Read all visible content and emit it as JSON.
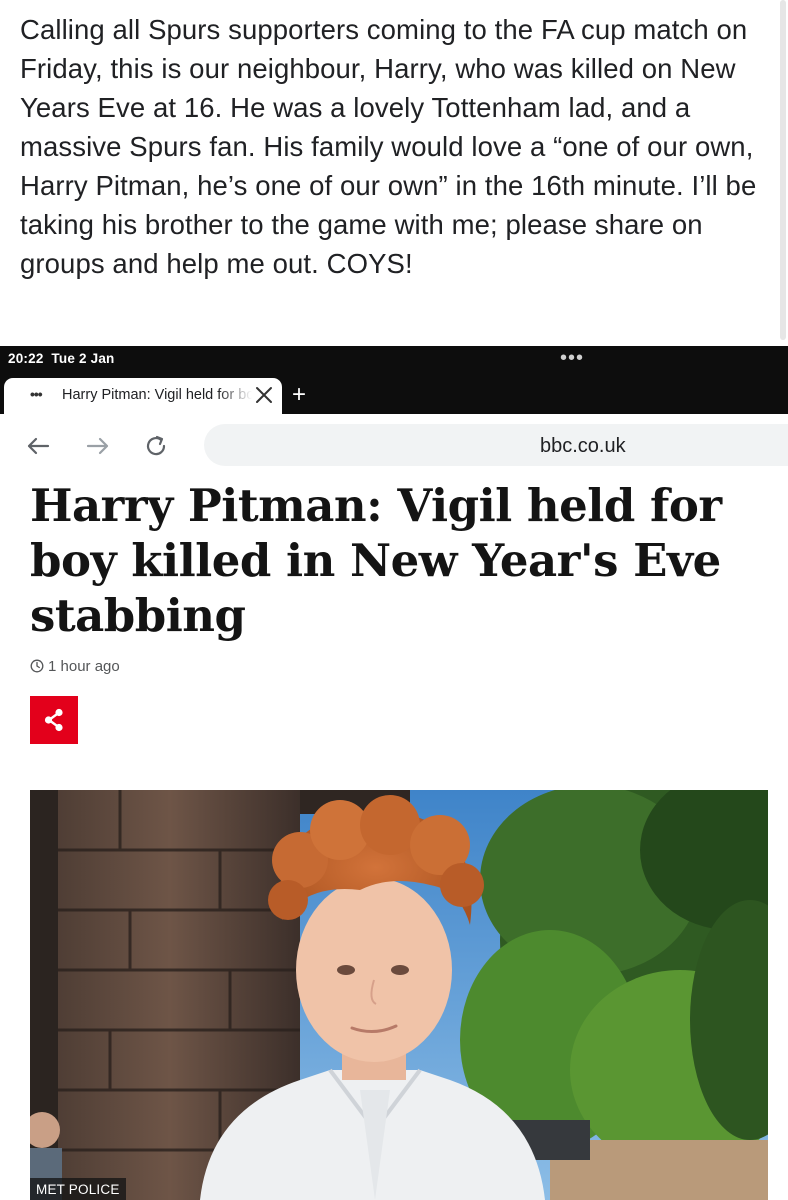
{
  "post": {
    "text": "Calling all Spurs supporters coming to the FA cup match on Friday, this is our neighbour, Harry, who was killed on New Years Eve at 16. He was a lovely Tottenham lad, and a massive Spurs fan. His family would love a “one of our own, Harry Pitman, he’s one of our own” in the 16th minute. I’ll be taking his brother to the game with me; please share on groups and help me out. COYS!"
  },
  "browser": {
    "status_time": "20:22  Tue 2 Jan",
    "status_dots": "•••",
    "tab": {
      "icon": "•••",
      "title": "Harry Pitman: Vigil held for boy killed"
    },
    "new_tab": "+",
    "url": "bbc.co.uk"
  },
  "article": {
    "headline": "Harry Pitman: Vigil held for boy killed in New Year's Eve stabbing",
    "timestamp": "1 hour ago",
    "image_credit": "MET POLICE"
  },
  "colors": {
    "share_red": "#e3001b",
    "status_bar": "#0d0d0d",
    "url_bar": "#f1f3f4"
  },
  "icons": [
    "back-arrow-icon",
    "forward-arrow-icon",
    "reload-icon",
    "close-icon",
    "clock-icon",
    "share-icon"
  ]
}
